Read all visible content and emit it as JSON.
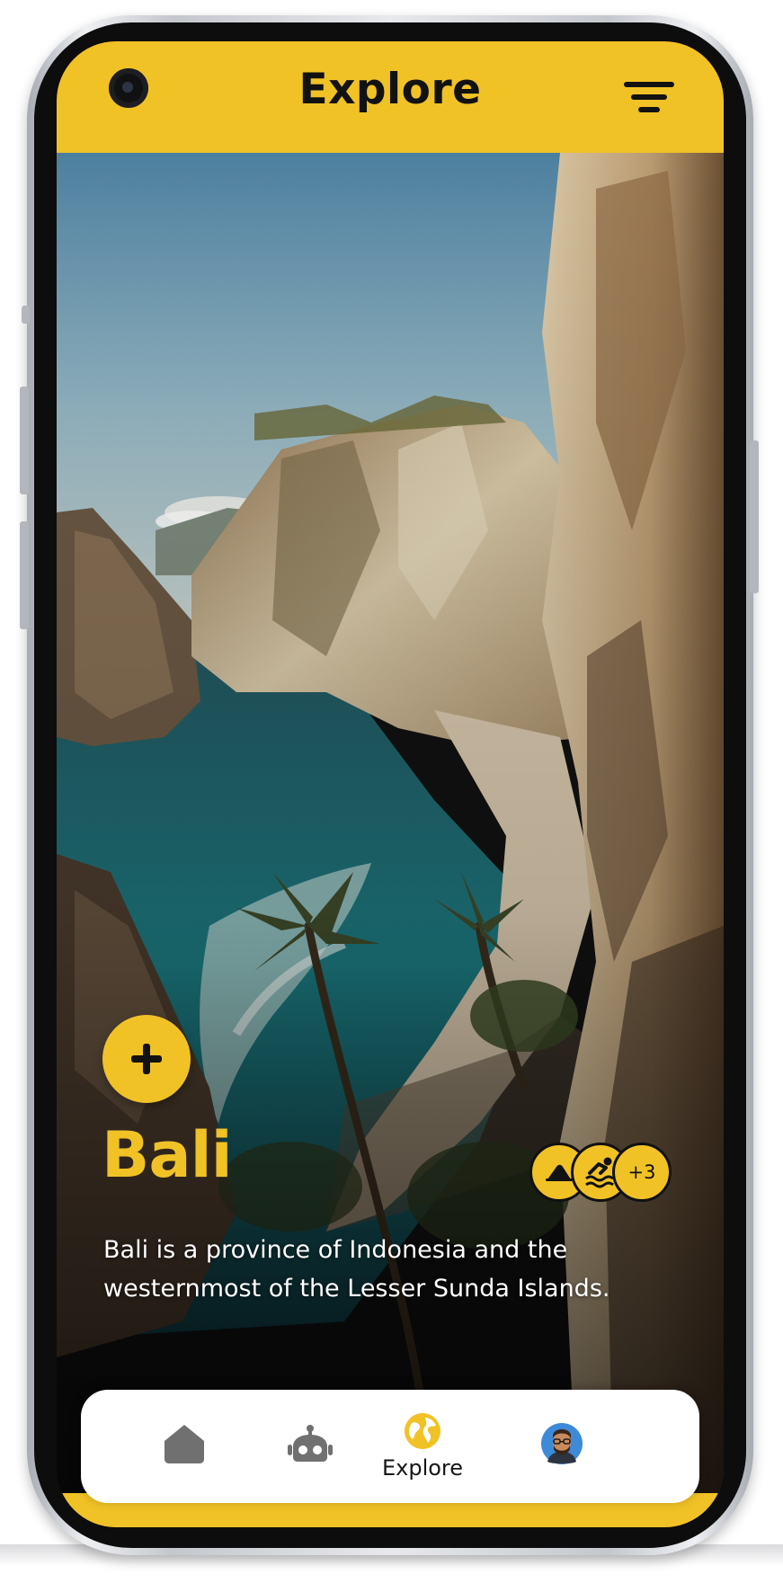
{
  "header": {
    "title": "Explore",
    "filter_icon": "filter-icon"
  },
  "destination": {
    "name": "Bali",
    "description": "Bali is a province of Indonesia and the westernmost of the Lesser Sunda Islands.",
    "add_icon": "plus-icon",
    "activities": {
      "icons": [
        "beach-icon",
        "swimming-icon"
      ],
      "more_label": "+3"
    }
  },
  "nav": {
    "items": [
      {
        "id": "home",
        "icon": "home-icon",
        "label": "",
        "active": false
      },
      {
        "id": "assistant",
        "icon": "robot-icon",
        "label": "",
        "active": false
      },
      {
        "id": "explore",
        "icon": "globe-icon",
        "label": "Explore",
        "active": true
      },
      {
        "id": "profile",
        "icon": "avatar",
        "label": "",
        "active": false
      }
    ]
  },
  "colors": {
    "accent": "#f1c226",
    "text_dark": "#121212",
    "icon_gray": "#707070",
    "nav_background": "#ffffff"
  }
}
